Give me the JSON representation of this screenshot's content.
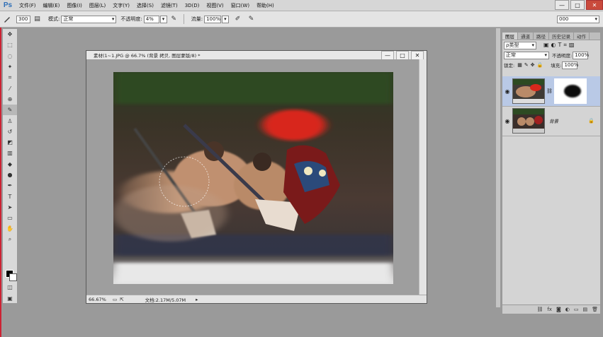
{
  "app": {
    "logo": "Ps"
  },
  "menu": [
    "文件(F)",
    "编辑(E)",
    "图像(I)",
    "图层(L)",
    "文字(Y)",
    "选择(S)",
    "滤镜(T)",
    "3D(D)",
    "视图(V)",
    "窗口(W)",
    "帮助(H)"
  ],
  "window_buttons": {
    "minimize": "—",
    "maximize": "□",
    "close": "✕"
  },
  "options": {
    "brush_size": "300",
    "mode_label": "模式:",
    "mode_value": "正常",
    "opacity_label": "不透明度:",
    "opacity_value": "4%",
    "flow_label": "流量:",
    "flow_value": "100%",
    "workspace_value": "000"
  },
  "document": {
    "title": "素材(1~1.JPG @ 66.7% (背景 拷贝, 图层蒙版/8) *",
    "zoom": "66.67%",
    "doc_info": "文档:2.17M/5.07M"
  },
  "layers_panel": {
    "tabs": [
      "图层",
      "通道",
      "路径",
      "历史记录",
      "动作"
    ],
    "filter_label": "ρ类型",
    "blend_mode": "正常",
    "opacity_label": "不透明度:",
    "opacity_value": "100%",
    "lock_label": "锁定:",
    "fill_label": "填充:",
    "fill_value": "100%",
    "layers": [
      {
        "name": "",
        "selected": true
      },
      {
        "name": "背景",
        "selected": false
      }
    ]
  },
  "colors": {
    "menubar": "#d6d6d6",
    "workspace": "#9a9a9a",
    "selection": "#b9c9e6",
    "accent": "#2f6fb7"
  },
  "tools": [
    "move-icon",
    "marquee-icon",
    "lasso-icon",
    "quick-select-icon",
    "crop-icon",
    "eyedropper-icon",
    "healing-icon",
    "brush-icon",
    "stamp-icon",
    "history-brush-icon",
    "eraser-icon",
    "gradient-icon",
    "blur-icon",
    "dodge-icon",
    "pen-icon",
    "type-icon",
    "path-select-icon",
    "shape-icon",
    "hand-icon",
    "zoom-icon"
  ]
}
